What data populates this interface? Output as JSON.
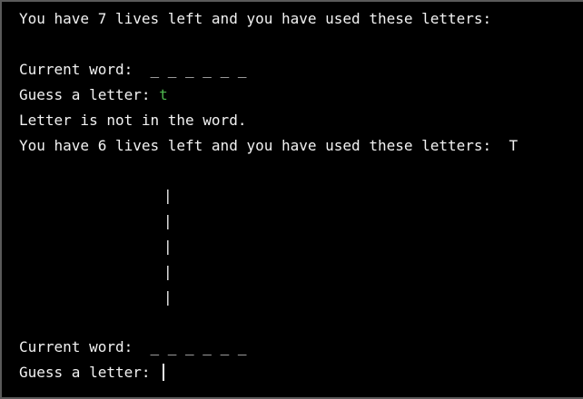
{
  "colors": {
    "background": "#000000",
    "text": "#f2f2f2",
    "user_input": "#4fb84f"
  },
  "terminal": {
    "line1": "You have 7 lives left and you have used these letters:",
    "line2_label": "Current word:  ",
    "line2_word": "_ _ _ _ _ _",
    "line3_prompt": "Guess a letter: ",
    "line3_input": "t",
    "line4": "Letter is not in the word.",
    "line5": "You have 6 lives left and you have used these letters:  T",
    "gallows_pipe": "|",
    "line6_label": "Current word:  ",
    "line6_word": "_ _ _ _ _ _",
    "line7_prompt": "Guess a letter: "
  }
}
